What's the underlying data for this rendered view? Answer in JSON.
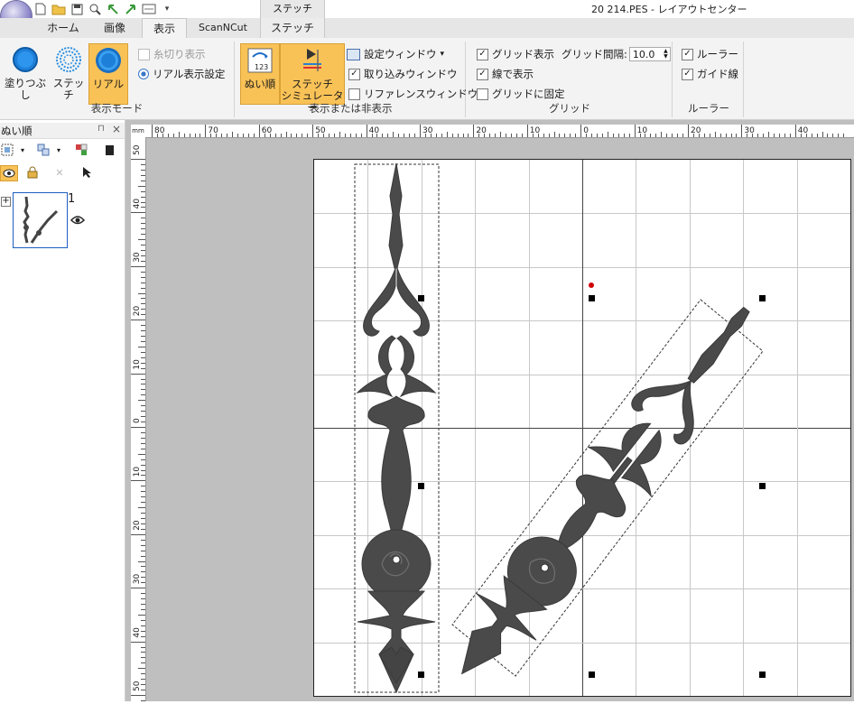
{
  "window": {
    "title": "20 214.PES - レイアウトセンター",
    "context_tab_header": "ステッチ"
  },
  "quick_access": {
    "icons": [
      "new-file-icon",
      "open-folder-icon",
      "save-icon",
      "zoom-icon",
      "undo-icon",
      "redo-icon",
      "screen-icon",
      "customize-arrow-icon"
    ]
  },
  "tabs": [
    {
      "label": "ホーム",
      "active": false
    },
    {
      "label": "画像",
      "active": false
    },
    {
      "label": "表示",
      "active": true
    },
    {
      "label": "ScanNCut",
      "active": false
    },
    {
      "label": "ステッチ",
      "active": false
    }
  ],
  "ribbon": {
    "display_mode": {
      "group_label": "表示モード",
      "fill_label": "塗りつぶし",
      "stitch_label": "ステッチ",
      "real_label": "リアル",
      "thread_cut_label": "糸切り表示",
      "real_settings_label": "リアル表示設定"
    },
    "show_hide": {
      "group_label": "表示または非表示",
      "sew_order_label": "ぬい順",
      "simulator_label_1": "ステッチ",
      "simulator_label_2": "シミュレーター",
      "settings_window_label": "設定ウィンドウ",
      "import_window_label": "取り込みウィンドウ",
      "import_window_checked": true,
      "reference_window_label": "リファレンスウィンドウ",
      "reference_window_checked": false
    },
    "grid": {
      "group_label": "グリッド",
      "show_grid_label": "グリッド表示",
      "show_grid_checked": true,
      "grid_interval_label": "グリッド間隔:",
      "grid_interval_value": "10.0",
      "show_as_lines_label": "線で表示",
      "show_as_lines_checked": true,
      "snap_to_grid_label": "グリッドに固定",
      "snap_to_grid_checked": false
    },
    "ruler": {
      "group_label": "ルーラー",
      "ruler_label": "ルーラー",
      "ruler_checked": true,
      "guide_label": "ガイド線",
      "guide_checked": true
    }
  },
  "sidebar": {
    "title": "ぬい順",
    "pin_icon": "pin-icon",
    "close_icon": "close-icon",
    "item_number": "1",
    "expand_symbol": "+"
  },
  "ruler": {
    "unit": "mm",
    "h_labels": [
      "80",
      "70",
      "60",
      "50",
      "40",
      "30",
      "20",
      "10",
      "0",
      "10",
      "20",
      "30",
      "40"
    ],
    "v_labels": [
      "50",
      "40",
      "30",
      "20",
      "10",
      "0",
      "10",
      "20",
      "30",
      "40",
      "50"
    ]
  },
  "colors": {
    "thread": "#4a4a4a",
    "accent_orange": "#f9c257",
    "ribbon_bg": "#f3f3f3",
    "canvas_bg": "#bfbfbf",
    "origin_marker": "#d00000"
  }
}
